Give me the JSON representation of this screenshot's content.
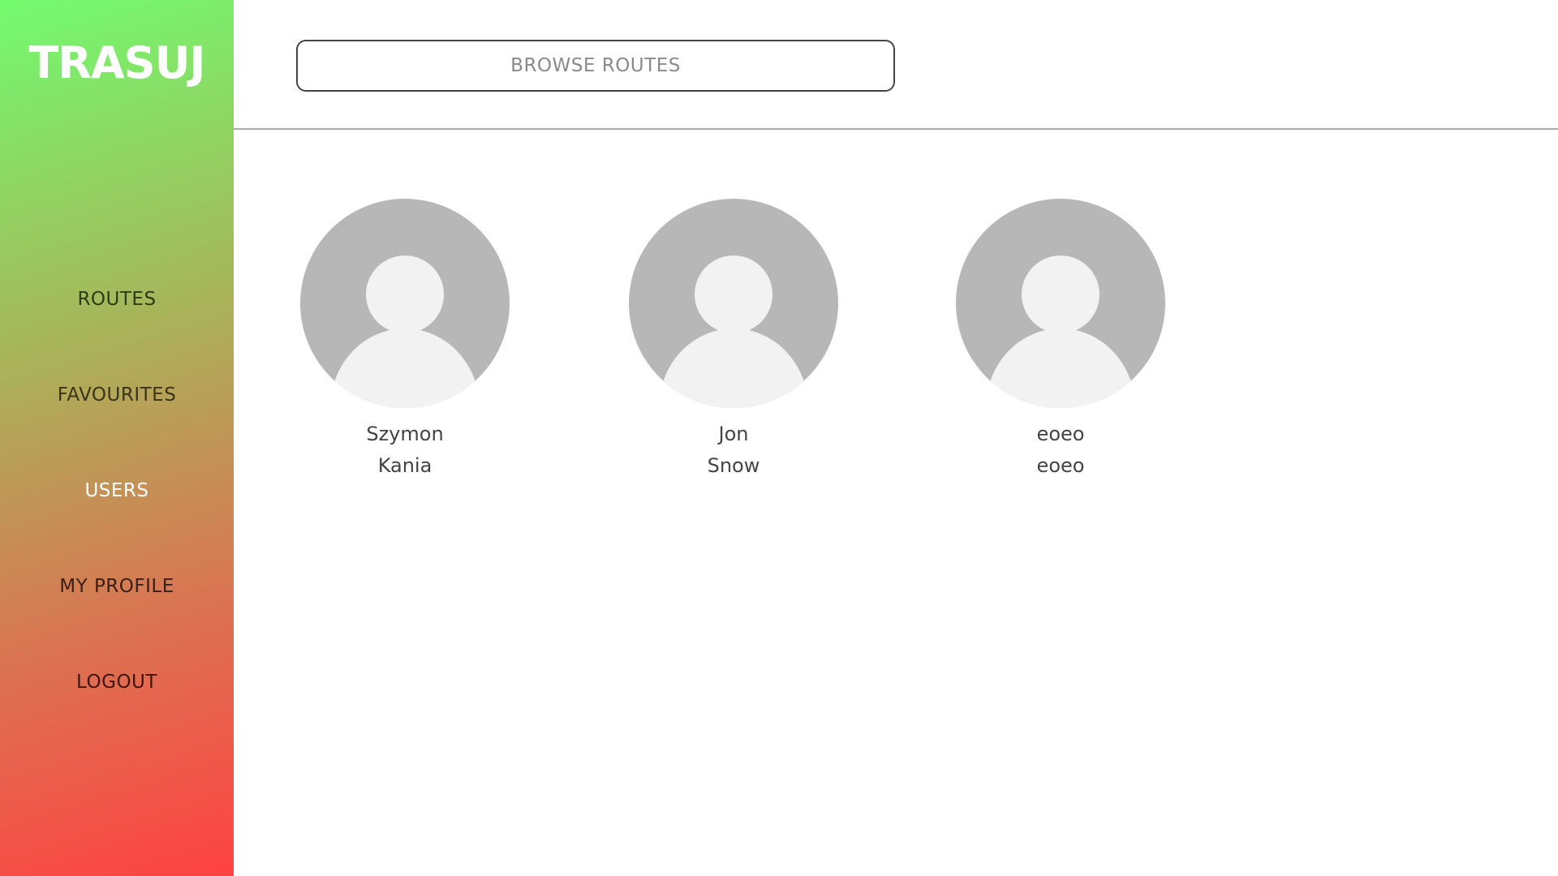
{
  "sidebar": {
    "logo": "TRASUJ",
    "items": [
      {
        "label": "ROUTES",
        "color": "#2e3a18"
      },
      {
        "label": "FAVOURITES",
        "color": "#3a3418"
      },
      {
        "label": "USERS",
        "color": "#ffffff"
      },
      {
        "label": "MY PROFILE",
        "color": "#3a1f14"
      },
      {
        "label": "LOGOUT",
        "color": "#3a1614"
      }
    ]
  },
  "header": {
    "browse_label": "BROWSE ROUTES"
  },
  "users": [
    {
      "first": "Szymon",
      "last": "Kania",
      "avatar_icon": "user-avatar-icon"
    },
    {
      "first": "Jon",
      "last": "Snow",
      "avatar_icon": "user-avatar-icon"
    },
    {
      "first": "eoeo",
      "last": "eoeo",
      "avatar_icon": "user-avatar-icon"
    }
  ],
  "colors": {
    "gradient_top": "#72fb6f",
    "gradient_bottom": "#ff4242",
    "avatar_bg": "#b7b7b7",
    "avatar_fg": "#f2f2f2"
  }
}
